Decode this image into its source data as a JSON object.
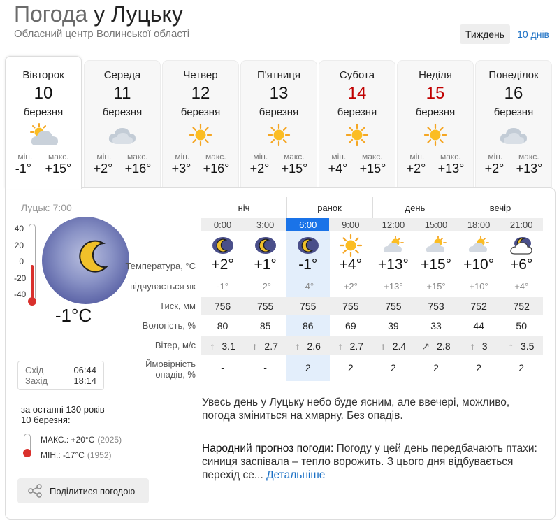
{
  "header": {
    "title_prefix": "Погода",
    "title_city": "у Луцьку",
    "subtitle": "Обласний центр Волинської області"
  },
  "period": {
    "week": "Тиждень",
    "ten": "10 днів"
  },
  "days": [
    {
      "name": "Вівторок",
      "date": "10",
      "month": "березня",
      "icon": "partly-cloudy-icon",
      "min_label": "мін.",
      "max_label": "макс.",
      "min": "-1°",
      "max": "+15°",
      "weekend": false
    },
    {
      "name": "Середа",
      "date": "11",
      "month": "березня",
      "icon": "cloudy-icon",
      "min_label": "мін.",
      "max_label": "макс.",
      "min": "+2°",
      "max": "+16°",
      "weekend": false
    },
    {
      "name": "Четвер",
      "date": "12",
      "month": "березня",
      "icon": "sun-icon",
      "min_label": "мін.",
      "max_label": "макс.",
      "min": "+3°",
      "max": "+16°",
      "weekend": false
    },
    {
      "name": "П'ятниця",
      "date": "13",
      "month": "березня",
      "icon": "sun-icon",
      "min_label": "мін.",
      "max_label": "макс.",
      "min": "+2°",
      "max": "+15°",
      "weekend": false
    },
    {
      "name": "Субота",
      "date": "14",
      "month": "березня",
      "icon": "sun-icon",
      "min_label": "мін.",
      "max_label": "макс.",
      "min": "+4°",
      "max": "+15°",
      "weekend": true
    },
    {
      "name": "Неділя",
      "date": "15",
      "month": "березня",
      "icon": "sun-icon",
      "min_label": "мін.",
      "max_label": "макс.",
      "min": "+2°",
      "max": "+13°",
      "weekend": true
    },
    {
      "name": "Понеділок",
      "date": "16",
      "month": "березня",
      "icon": "cloudy-icon",
      "min_label": "мін.",
      "max_label": "макс.",
      "min": "+2°",
      "max": "+13°",
      "weekend": false
    }
  ],
  "now": {
    "label": "Луцьк: 7:00",
    "temp": "-1°C",
    "scale": [
      "40",
      "20",
      "0",
      "-20",
      "-40"
    ]
  },
  "sun": {
    "rise_label": "Схід",
    "rise": "06:44",
    "set_label": "Захід",
    "set": "18:14"
  },
  "history": {
    "caption": "за останні 130 років",
    "date": "10 березня:",
    "max_label": "МАКС.:",
    "max": "+20°C",
    "max_year": "(2025)",
    "min_label": "МІН.:",
    "min": "-17°C",
    "min_year": "(1952)"
  },
  "share": "Поділитися погодою",
  "parts": [
    "ніч",
    "ранок",
    "день",
    "вечір"
  ],
  "hours": [
    "0:00",
    "3:00",
    "6:00",
    "9:00",
    "12:00",
    "15:00",
    "18:00",
    "21:00"
  ],
  "hour_icons": [
    "moon-cloud-icon",
    "moon-cloud-icon",
    "moon-cloud-icon",
    "sun-icon",
    "sun-cloud-icon",
    "sun-cloud-icon",
    "sun-cloud-icon",
    "cloud-moon-icon"
  ],
  "labels": {
    "temp": "Температура, °С",
    "feels": "відчувається як",
    "pressure": "Тиск, мм",
    "humidity": "Вологість, %",
    "wind": "Вітер, м/с",
    "precip1": "Ймовірність",
    "precip2": "опадів, %"
  },
  "temp": [
    "+2°",
    "+1°",
    "-1°",
    "+4°",
    "+13°",
    "+15°",
    "+10°",
    "+6°"
  ],
  "feels": [
    "-1°",
    "-2°",
    "-4°",
    "+2°",
    "+13°",
    "+15°",
    "+10°",
    "+4°"
  ],
  "pressure": [
    "756",
    "755",
    "755",
    "755",
    "755",
    "753",
    "752",
    "752"
  ],
  "humidity": [
    "80",
    "85",
    "86",
    "69",
    "39",
    "33",
    "44",
    "50"
  ],
  "wind": [
    "3.1",
    "2.7",
    "2.6",
    "2.7",
    "2.4",
    "2.8",
    "3",
    "3.5"
  ],
  "wind_dir": [
    "↑",
    "↑",
    "↑",
    "↑",
    "↑",
    "↗",
    "↑",
    "↑"
  ],
  "precip": [
    "-",
    "-",
    "2",
    "2",
    "2",
    "2",
    "2",
    "2"
  ],
  "description": "Увесь день у Луцьку небо буде ясним, але ввечері, можливо, погода зміниться на хмарну. Без опадів.",
  "folk": {
    "label": "Народний прогноз погоди:",
    "text": "Погоду у цей день передбачають птахи: синиця заспівала – тепло ворожить. З цього дня відбувається перехід се...",
    "more": "Детальніше"
  }
}
